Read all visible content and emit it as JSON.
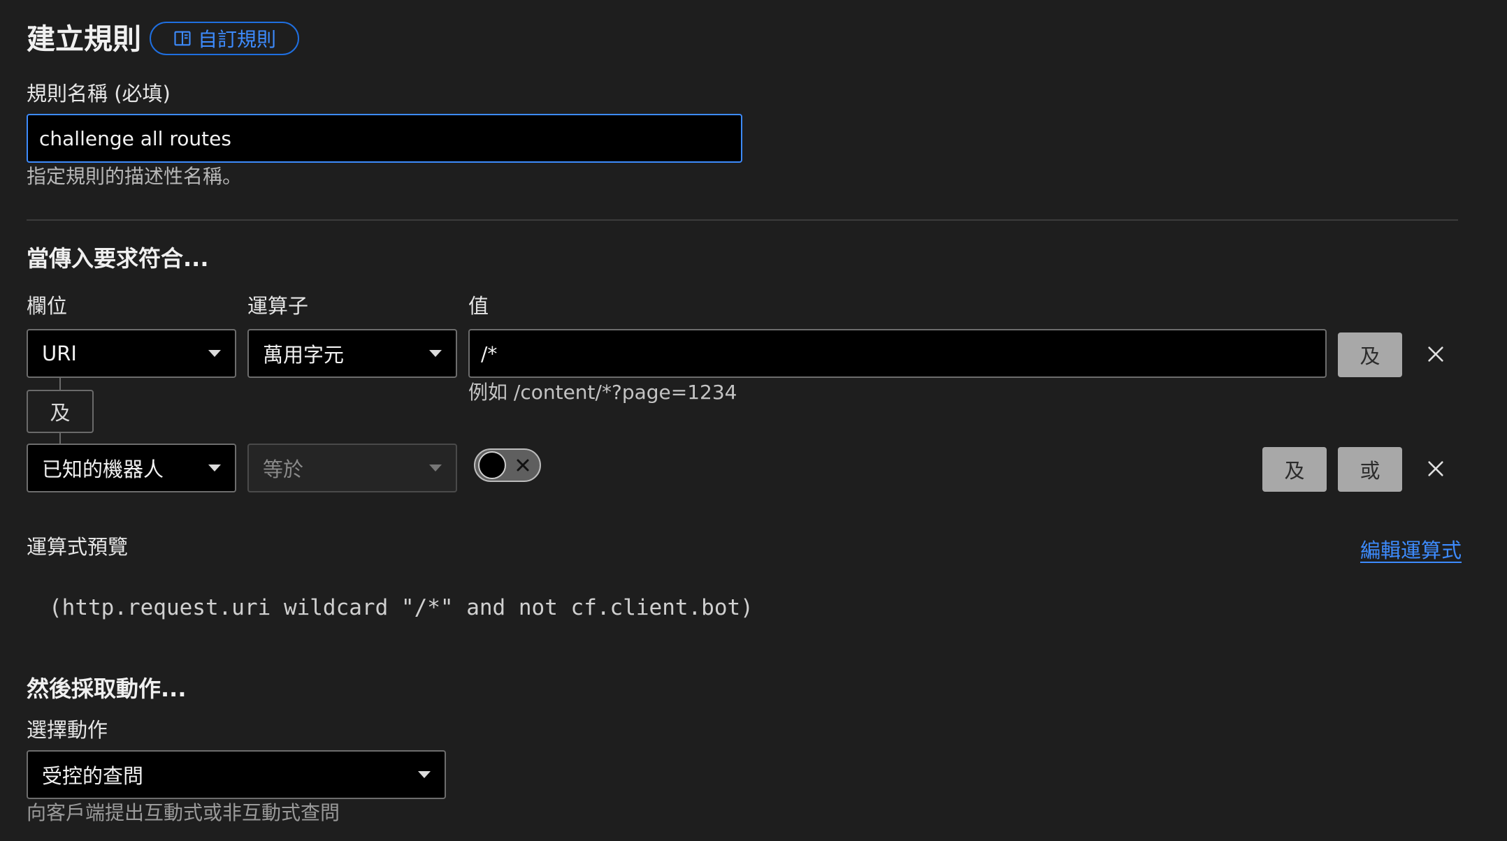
{
  "header": {
    "title": "建立規則",
    "doc_link_label": "自訂規則"
  },
  "rule_name": {
    "label": "規則名稱 (必填)",
    "value": "challenge all routes",
    "hint": "指定規則的描述性名稱。"
  },
  "match": {
    "section_title": "當傳入要求符合...",
    "col_field": "欄位",
    "col_operator": "運算子",
    "col_value": "值",
    "row1": {
      "field": "URI",
      "operator": "萬用字元",
      "value": "/*",
      "example": "例如 /content/*?page=1234",
      "and_label": "及"
    },
    "connector_label": "及",
    "row2": {
      "field": "已知的機器人",
      "operator": "等於",
      "toggle_on": false,
      "and_label": "及",
      "or_label": "或"
    }
  },
  "preview": {
    "label": "運算式預覽",
    "edit_link": "編輯運算式",
    "expression": "(http.request.uri wildcard \"/*\" and not cf.client.bot)"
  },
  "action": {
    "section_title": "然後採取動作...",
    "label": "選擇動作",
    "value": "受控的查問",
    "hint": "向客戶端提出互動式或非互動式查問"
  },
  "colors": {
    "background": "#1e1e1e",
    "accent": "#3d8bfd",
    "button_gray": "#a8a8a8"
  }
}
